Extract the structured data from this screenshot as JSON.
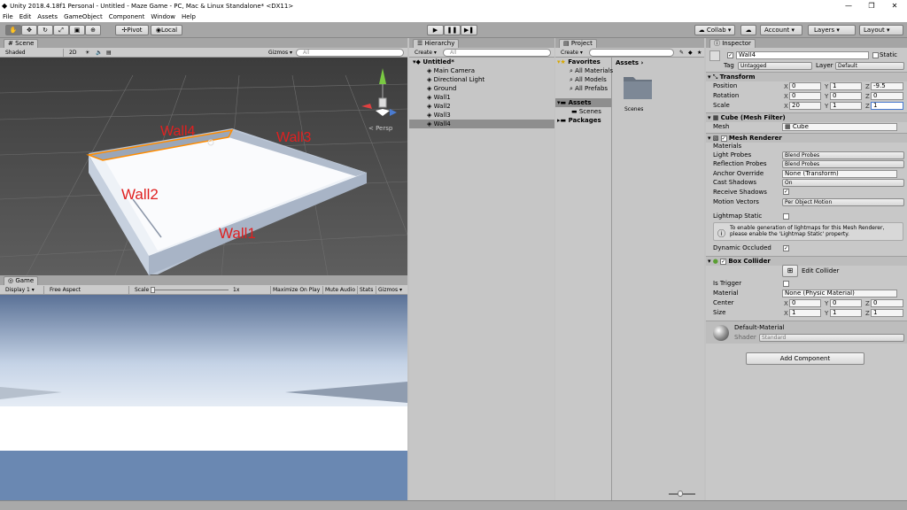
{
  "window": {
    "title": "Unity 2018.4.18f1 Personal - Untitled - Maze Game - PC, Mac & Linux Standalone* <DX11>",
    "minimize": "—",
    "maximize": "❐",
    "close": "✕"
  },
  "menu": [
    "File",
    "Edit",
    "Assets",
    "GameObject",
    "Component",
    "Window",
    "Help"
  ],
  "toolbar": {
    "pivot": "Pivot",
    "local": "Local",
    "collab": "Collab ▾",
    "account": "Account",
    "layers": "Layers",
    "layout": "Layout"
  },
  "scene": {
    "tab": "Scene",
    "shading": "Shaded",
    "mode2d": "2D",
    "gizmos": "Gizmos",
    "search": "All",
    "persp": "< Persp",
    "labels": {
      "wall1": "Wall1",
      "wall2": "Wall2",
      "wall3": "Wall3",
      "wall4": "Wall4"
    }
  },
  "game": {
    "tab": "Game",
    "display": "Display 1",
    "aspect": "Free Aspect",
    "scale": "Scale",
    "scale_value": "1x",
    "maximize": "Maximize On Play",
    "mute": "Mute Audio",
    "stats": "Stats",
    "gizmos": "Gizmos"
  },
  "hierarchy": {
    "tab": "Hierarchy",
    "create": "Create",
    "search": "All",
    "scene": "Untitled*",
    "items": [
      "Main Camera",
      "Directional Light",
      "Ground",
      "Wall1",
      "Wall2",
      "Wall3",
      "Wall4"
    ]
  },
  "project": {
    "tab": "Project",
    "create": "Create",
    "favorites": "Favorites",
    "fav_items": [
      "All Materials",
      "All Models",
      "All Prefabs"
    ],
    "assets": "Assets",
    "scenes": "Scenes",
    "packages": "Packages",
    "breadcrumb": "Assets ›",
    "folder": "Scenes"
  },
  "inspector": {
    "tab": "Inspector",
    "name": "Wall4",
    "static": "Static",
    "tag_label": "Tag",
    "tag": "Untagged",
    "layer_label": "Layer",
    "layer": "Default",
    "transform": {
      "title": "Transform",
      "position": "Position",
      "rotation": "Rotation",
      "scale": "Scale",
      "pos": [
        "0",
        "1",
        "-9.5"
      ],
      "rot": [
        "0",
        "0",
        "0"
      ],
      "scl": [
        "20",
        "1",
        "1"
      ]
    },
    "filter": {
      "title": "Cube (Mesh Filter)",
      "mesh_label": "Mesh",
      "mesh": "Cube"
    },
    "renderer": {
      "title": "Mesh Renderer",
      "materials": "Materials",
      "light_probes": "Light Probes",
      "light_probes_v": "Blend Probes",
      "reflection": "Reflection Probes",
      "reflection_v": "Blend Probes",
      "anchor": "Anchor Override",
      "anchor_v": "None (Transform)",
      "cast": "Cast Shadows",
      "cast_v": "On",
      "receive": "Receive Shadows",
      "motion": "Motion Vectors",
      "motion_v": "Per Object Motion",
      "lightmap": "Lightmap Static",
      "info": "To enable generation of lightmaps for this Mesh Renderer, please enable the 'Lightmap Static' property.",
      "occluded": "Dynamic Occluded"
    },
    "collider": {
      "title": "Box Collider",
      "edit": "Edit Collider",
      "trigger": "Is Trigger",
      "material_label": "Material",
      "material": "None (Physic Material)",
      "center": "Center",
      "size": "Size",
      "c": [
        "0",
        "0",
        "0"
      ],
      "s": [
        "1",
        "1",
        "1"
      ]
    },
    "material": {
      "name": "Default-Material",
      "shader_label": "Shader",
      "shader": "Standard"
    },
    "add": "Add Component"
  },
  "axes": [
    "X",
    "Y",
    "Z"
  ]
}
